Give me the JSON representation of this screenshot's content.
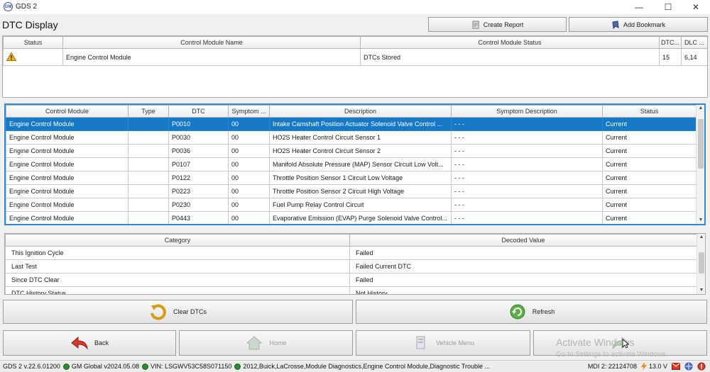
{
  "window": {
    "title": "GDS 2",
    "app_icon": "gm-globe-icon",
    "controls": [
      "minimize",
      "maximize",
      "close"
    ]
  },
  "header": {
    "title": "DTC Display",
    "create_report_label": "Create Report",
    "add_bookmark_label": "Add Bookmark"
  },
  "modules_table": {
    "columns": [
      "Status",
      "Control Module Name",
      "Control Module Status",
      "DTC...",
      "DLC ..."
    ],
    "rows": [
      {
        "status_icon": "warning-icon",
        "name": "Engine Control Module",
        "module_status": "DTCs Stored",
        "dtc_count": "15",
        "dlc": "6,14"
      }
    ]
  },
  "dtc_table": {
    "columns": [
      "Control Module",
      "Type",
      "DTC",
      "Symptom ...",
      "Description",
      "Symptom Description",
      "Status"
    ],
    "rows": [
      {
        "module": "Engine Control Module",
        "type": "",
        "dtc": "P0010",
        "symptom": "00",
        "description": "Intake Camshaft Position Actuator Solenoid Valve Control ...",
        "symptom_desc": "- - -",
        "status": "Current",
        "selected": true
      },
      {
        "module": "Engine Control Module",
        "type": "",
        "dtc": "P0030",
        "symptom": "00",
        "description": "HO2S Heater Control Circuit Sensor 1",
        "symptom_desc": "- - -",
        "status": "Current"
      },
      {
        "module": "Engine Control Module",
        "type": "",
        "dtc": "P0036",
        "symptom": "00",
        "description": "HO2S Heater Control Circuit Sensor 2",
        "symptom_desc": "- - -",
        "status": "Current"
      },
      {
        "module": "Engine Control Module",
        "type": "",
        "dtc": "P0107",
        "symptom": "00",
        "description": "Manifold Absolute Pressure (MAP) Sensor Circuit Low Volt...",
        "symptom_desc": "- - -",
        "status": "Current"
      },
      {
        "module": "Engine Control Module",
        "type": "",
        "dtc": "P0122",
        "symptom": "00",
        "description": "Throttle Position Sensor 1 Circuit Low Voltage",
        "symptom_desc": "- - -",
        "status": "Current"
      },
      {
        "module": "Engine Control Module",
        "type": "",
        "dtc": "P0223",
        "symptom": "00",
        "description": "Throttle Position Sensor 2 Circuit High Voltage",
        "symptom_desc": "- - -",
        "status": "Current"
      },
      {
        "module": "Engine Control Module",
        "type": "",
        "dtc": "P0230",
        "symptom": "00",
        "description": "Fuel Pump Relay Control Circuit",
        "symptom_desc": "- - -",
        "status": "Current"
      },
      {
        "module": "Engine Control Module",
        "type": "",
        "dtc": "P0443",
        "symptom": "00",
        "description": "Evaporative Emission (EVAP) Purge Solenoid Valve Control...",
        "symptom_desc": "- - -",
        "status": "Current"
      }
    ]
  },
  "decode_table": {
    "columns": [
      "Category",
      "Decoded Value"
    ],
    "rows": [
      {
        "category": "This Ignition Cycle",
        "value": "Failed"
      },
      {
        "category": "Last Test",
        "value": "Failed Current DTC"
      },
      {
        "category": "Since DTC Clear",
        "value": "Failed"
      },
      {
        "category": "DTC History Status",
        "value": "Not History"
      }
    ]
  },
  "actions": {
    "clear_dtcs_label": "Clear DTCs",
    "refresh_label": "Refresh"
  },
  "nav": {
    "back_label": "Back",
    "home_label": "Home",
    "vehicle_menu_label": "Vehicle Menu"
  },
  "watermark": {
    "line1": "Activate Windows",
    "line2": "Go to Settings to activate Windows."
  },
  "statusbar": {
    "version": "GDS 2 v.22.6.01200",
    "global": "GM Global v2024.05.08",
    "vin": "VIN: LSGWV53C58S071150",
    "path": "2012,Buick,LaCrosse,Module Diagnostics,Engine Control Module,Diagnostic Trouble ...",
    "mdi": "MDI 2: 22124708",
    "voltage": "13.0 V"
  },
  "colors": {
    "selection": "#1679c8",
    "panel_border": "#2a8ad4",
    "status_dot": "#2e8a2e"
  }
}
